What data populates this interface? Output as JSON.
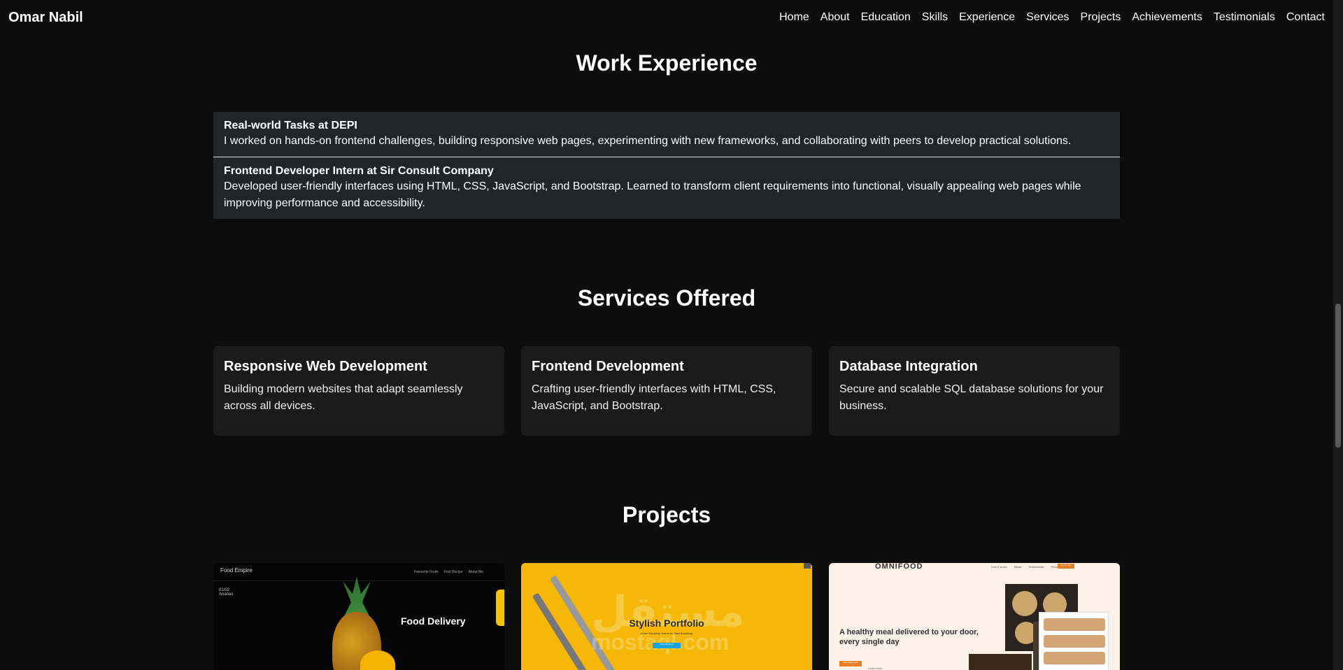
{
  "navbar": {
    "brand": "Omar Nabil",
    "links": [
      "Home",
      "About",
      "Education",
      "Skills",
      "Experience",
      "Services",
      "Projects",
      "Achievements",
      "Testimonials",
      "Contact"
    ]
  },
  "experience": {
    "title": "Work Experience",
    "items": [
      {
        "title": "Real-world Tasks at DEPI",
        "description": "I worked on hands-on frontend challenges, building responsive web pages, experimenting with new frameworks, and collaborating with peers to develop practical solutions."
      },
      {
        "title": "Frontend Developer Intern at Sir Consult Company",
        "description": "Developed user-friendly interfaces using HTML, CSS, JavaScript, and Bootstrap. Learned to transform client requirements into functional, visually appealing web pages while improving performance and accessibility."
      }
    ]
  },
  "services": {
    "title": "Services Offered",
    "items": [
      {
        "title": "Responsive Web Development",
        "description": "Building modern websites that adapt seamlessly across all devices."
      },
      {
        "title": "Frontend Development",
        "description": "Crafting user-friendly interfaces with HTML, CSS, JavaScript, and Bootstrap."
      },
      {
        "title": "Database Integration",
        "description": "Secure and scalable SQL database solutions for your business."
      }
    ]
  },
  "projects": {
    "title": "Projects",
    "items": [
      {
        "brand": "Food Empire",
        "nav": [
          "Favourite Fruits",
          "Fruit Recipe",
          "About Me"
        ],
        "page_number": "01/02",
        "product": "Ananas",
        "heading": "Food Delivery"
      },
      {
        "heading": "Stylish Portfolio",
        "subheading": "A free Bootstrap theme by Start Bootstrap",
        "button": "Find Out More",
        "watermark": "مستقل",
        "watermark_url": "mostaql.com"
      },
      {
        "logo": "OMNIFOOD",
        "nav": [
          "How it works",
          "Meals",
          "Testimonials",
          "Pricing"
        ],
        "cta": "Try for free",
        "heading": "A healthy meal delivered to your door, every single day",
        "button": "Start eating well",
        "link": "Learn more"
      }
    ]
  },
  "colors": {
    "background": "#0d0d0d",
    "card": "#1b1b1b",
    "list": "#212529",
    "accent_yellow": "#f5b808",
    "accent_orange": "#e67e22"
  }
}
